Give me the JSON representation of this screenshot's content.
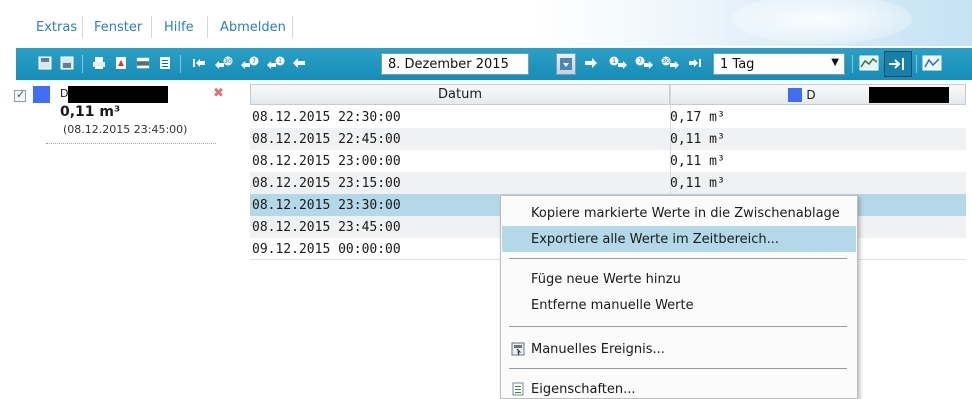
{
  "menu": {
    "items": [
      "Extras",
      "Fenster",
      "Hilfe",
      "Abmelden"
    ]
  },
  "toolbar": {
    "date_value": "8. Dezember 2015",
    "range_value": "1 Tag",
    "nav_badges": [
      "30",
      "7",
      "1",
      "1",
      "7",
      "30"
    ],
    "icons": [
      "save-icon",
      "save-as-icon",
      "print-icon",
      "pdf-icon",
      "csv-icon",
      "list-icon",
      "jump-start-icon",
      "back-30-icon",
      "back-7-icon",
      "back-1-icon",
      "prev-icon",
      "calendar-icon",
      "next-icon",
      "forward-1-icon",
      "forward-7-icon",
      "forward-30-icon",
      "jump-end-icon",
      "chart-icon",
      "align-right-icon",
      "line-chart-icon"
    ],
    "colors": {
      "bar": "#1a94bd",
      "icon": "#ffffff"
    }
  },
  "series": {
    "color": "#3f6ef2",
    "label_visible": "D",
    "value": "0,11 m³",
    "time": "(08.12.2015 23:45:00)",
    "checked": true
  },
  "table": {
    "columns": [
      "Datum",
      "D"
    ],
    "rows": [
      {
        "datum": "08.12.2015 22:30:00",
        "wert": "0,17 m³"
      },
      {
        "datum": "08.12.2015 22:45:00",
        "wert": "0,11 m³"
      },
      {
        "datum": "08.12.2015 23:00:00",
        "wert": "0,11 m³"
      },
      {
        "datum": "08.12.2015 23:15:00",
        "wert": "0,11 m³"
      },
      {
        "datum": "08.12.2015 23:30:00",
        "wert": ""
      },
      {
        "datum": "08.12.2015 23:45:00",
        "wert": ""
      },
      {
        "datum": "09.12.2015 00:00:00",
        "wert": ""
      }
    ],
    "selected_row": 4,
    "colors": {
      "selected": "#b3d8e8",
      "alt": "#f0f1f2"
    }
  },
  "context_menu": {
    "items": [
      "Kopiere markierte Werte in die Zwischenablage",
      "Exportiere alle Werte im Zeitbereich...",
      "Füge neue Werte hinzu",
      "Entferne manuelle Werte",
      "Manuelles Ereignis...",
      "Eigenschaften..."
    ],
    "highlighted": 1
  }
}
